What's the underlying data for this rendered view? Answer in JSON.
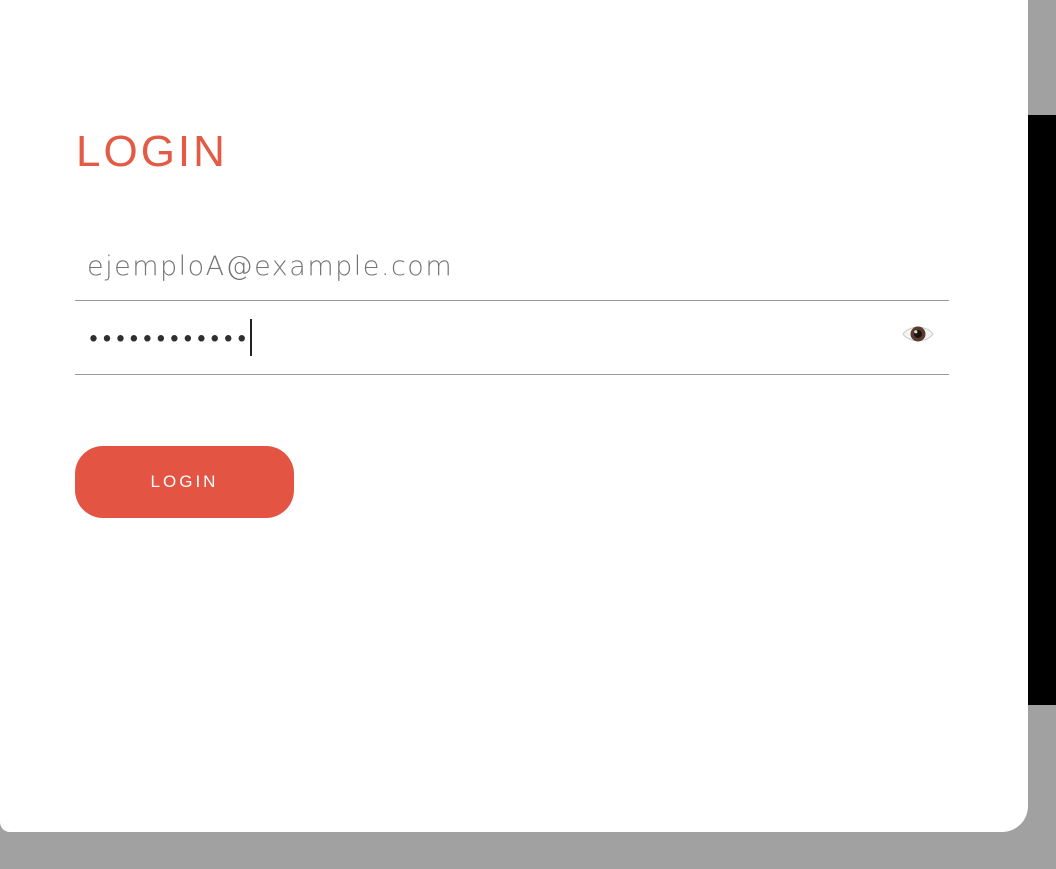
{
  "login_form": {
    "title": "LOGIN",
    "email": {
      "value": "ejemploA@example.com",
      "placeholder": ""
    },
    "password": {
      "masked_value": "••••••••••••",
      "toggle_icon": "eye-icon"
    },
    "submit_label": "LOGIN"
  },
  "colors": {
    "accent": "#e35443",
    "background": "#a1a1a1",
    "card": "#ffffff"
  }
}
